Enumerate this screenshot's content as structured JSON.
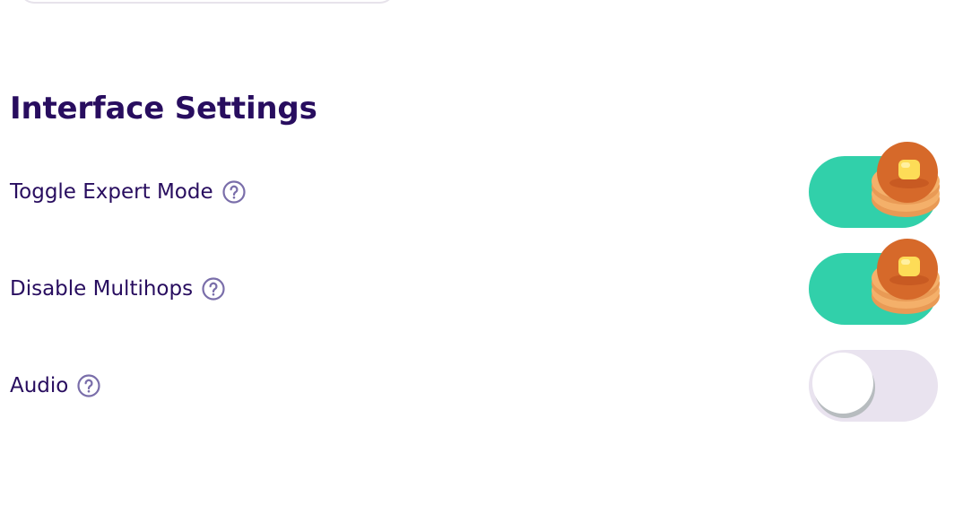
{
  "section": {
    "title": "Interface Settings"
  },
  "settings": [
    {
      "label": "Toggle Expert Mode",
      "enabled": true,
      "help_icon": "question-circle-icon"
    },
    {
      "label": "Disable Multihops",
      "enabled": true,
      "help_icon": "question-circle-icon"
    },
    {
      "label": "Audio",
      "enabled": false,
      "help_icon": "question-circle-icon"
    }
  ],
  "colors": {
    "title_text": "#280d5f",
    "toggle_on": "#31d0aa",
    "toggle_off": "#e9e3ef",
    "help_icon": "#7a6eaa",
    "pancake": "#d6692a",
    "pancake_light": "#f4b06a",
    "butter": "#fddc57"
  }
}
